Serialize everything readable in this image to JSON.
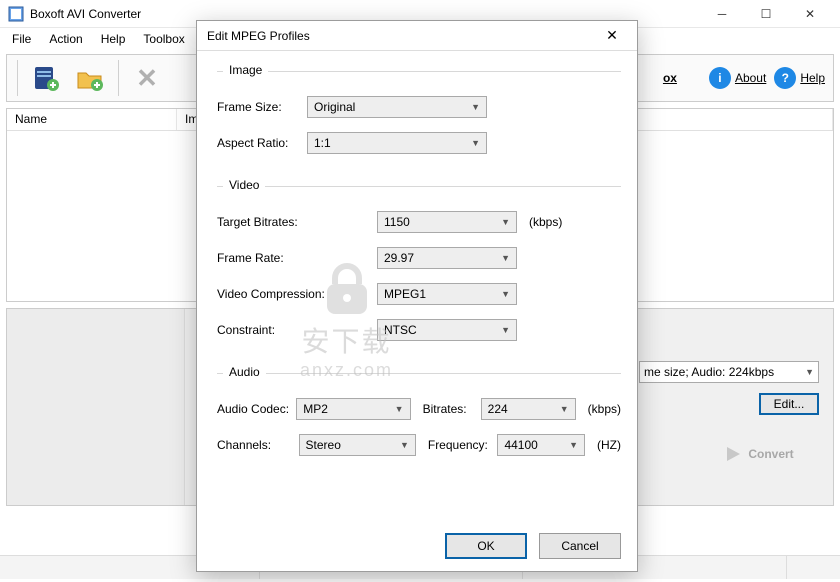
{
  "window": {
    "title": "Boxoft AVI Converter",
    "menu": [
      "File",
      "Action",
      "Help",
      "Toolbox"
    ],
    "columns": [
      "Name",
      "Imformation"
    ],
    "right_buttons": {
      "about": "About",
      "help": "Help",
      "toolbox_suffix": "ox"
    },
    "output_combo": "me size; Audio: 224kbps",
    "edit": "Edit...",
    "convert": "Convert"
  },
  "dialog": {
    "title": "Edit MPEG Profiles",
    "groups": {
      "image": "Image",
      "video": "Video",
      "audio": "Audio"
    },
    "labels": {
      "frame_size": "Frame Size:",
      "aspect_ratio": "Aspect Ratio:",
      "target_bitrates": "Target Bitrates:",
      "frame_rate": "Frame Rate:",
      "video_compression": "Video Compression:",
      "constraint": "Constraint:",
      "audio_codec": "Audio Codec:",
      "bitrates": "Bitrates:",
      "channels": "Channels:",
      "frequency": "Frequency:"
    },
    "values": {
      "frame_size": "Original",
      "aspect_ratio": "1:1",
      "target_bitrates": "1150",
      "frame_rate": "29.97",
      "video_compression": "MPEG1",
      "constraint": "NTSC",
      "audio_codec": "MP2",
      "bitrates": "224",
      "channels": "Stereo",
      "frequency": "44100"
    },
    "units": {
      "kbps": "(kbps)",
      "hz": "(HZ)"
    },
    "actions": {
      "ok": "OK",
      "cancel": "Cancel"
    }
  },
  "watermark": {
    "cn": "安下载",
    "en": "anxz.com"
  }
}
